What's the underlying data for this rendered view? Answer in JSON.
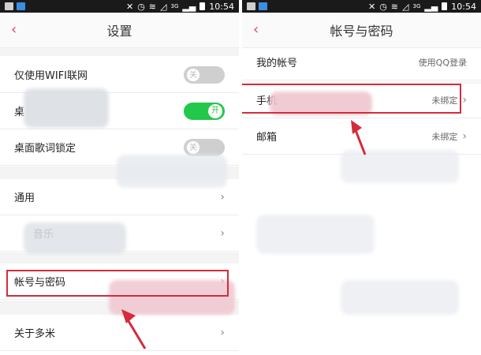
{
  "status_bar": {
    "time": "10:54",
    "network": "3G"
  },
  "left": {
    "title": "设置",
    "rows": [
      {
        "label": "仅使用WIFI联网",
        "toggle_state": "off",
        "toggle_text": "关"
      },
      {
        "label": "桌",
        "toggle_state": "on",
        "toggle_text": "开"
      },
      {
        "label": "桌面歌词锁定",
        "toggle_state": "off",
        "toggle_text": "关"
      },
      {
        "label": "通用"
      },
      {
        "label": "音乐"
      },
      {
        "label": "帐号与密码"
      },
      {
        "label": "关于多米"
      }
    ]
  },
  "right": {
    "title": "帐号与密码",
    "rows": [
      {
        "label": "我的帐号",
        "value": "使用QQ登录"
      },
      {
        "label": "手机",
        "value": "未绑定"
      },
      {
        "label": "邮箱",
        "value": "未绑定"
      }
    ]
  },
  "icons": {
    "back": "‹",
    "chevron": "›"
  },
  "colors": {
    "accent": "#e0405f",
    "highlight": "#d32c3b",
    "toggle_on": "#22c84a",
    "toggle_off": "#cfcfcf"
  }
}
